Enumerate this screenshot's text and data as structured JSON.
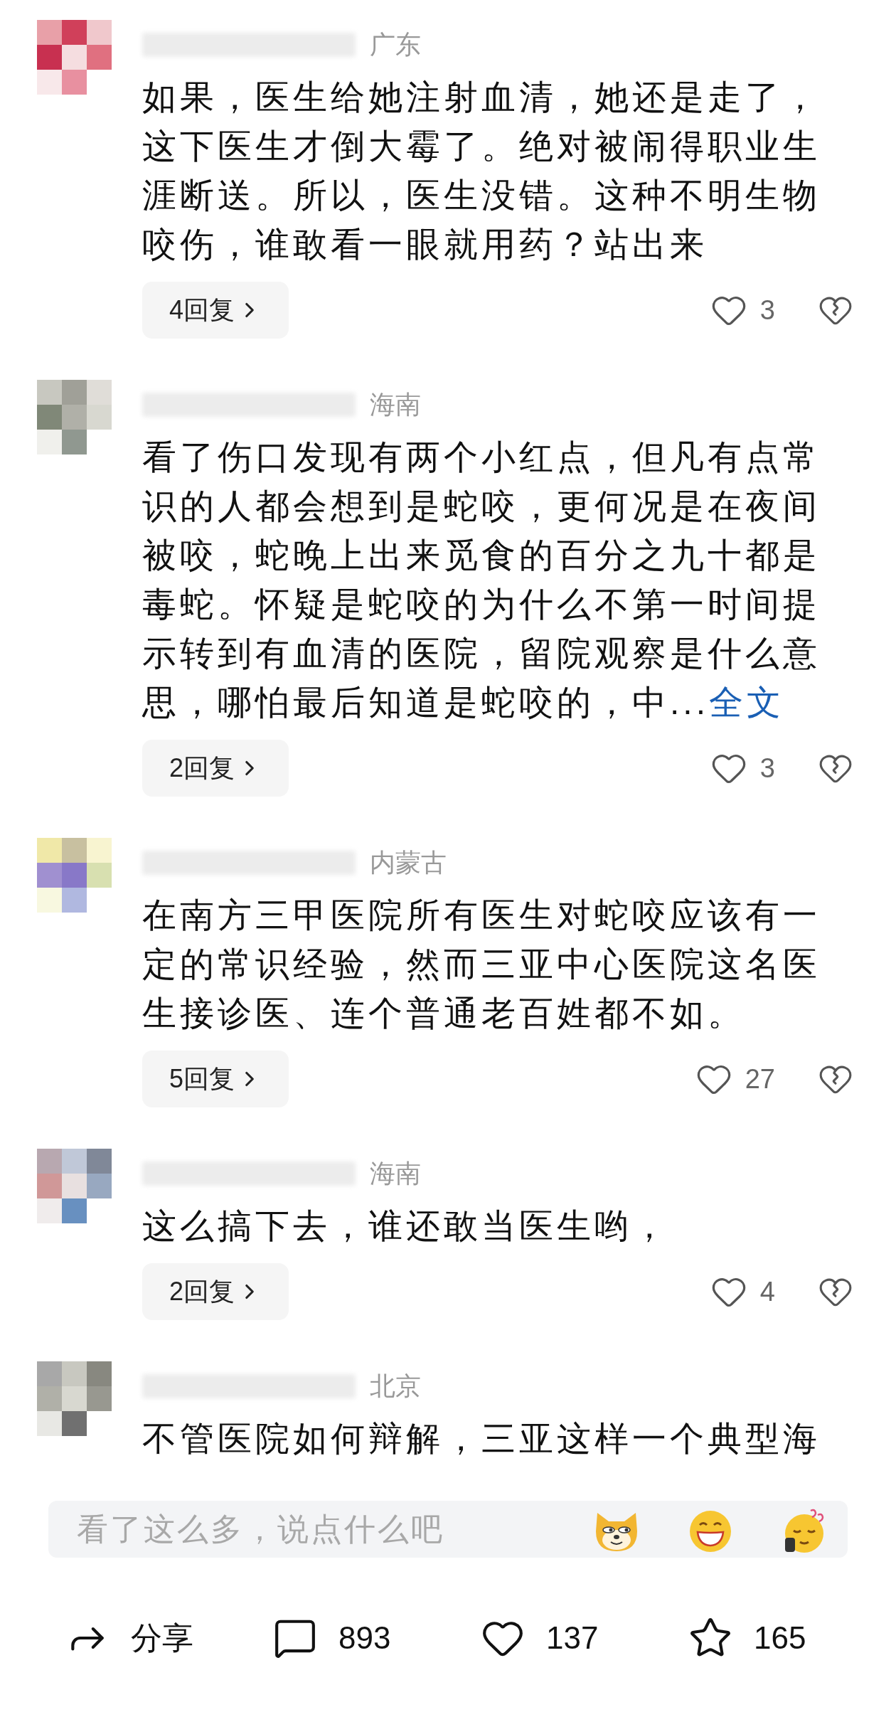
{
  "comments": [
    {
      "location": "广东",
      "text": "如果，医生给她注射血清，她还是走了，这下医生才倒大霉了。绝对被闹得职业生涯断送。所以，医生没错。这种不明生物咬伤，谁敢看一眼就用药？站出来",
      "replies": "4回复",
      "likes": "3"
    },
    {
      "location": "海南",
      "text": "看了伤口发现有两个小红点，但凡有点常识的人都会想到是蛇咬，更何况是在夜间被咬，蛇晚上出来觅食的百分之九十都是毒蛇。怀疑是蛇咬的为什么不第一时间提示转到有血清的医院，留院观察是什么意思，哪怕最后知道是蛇咬的，中...",
      "more_link": "全文",
      "replies": "2回复",
      "likes": "3"
    },
    {
      "location": "内蒙古",
      "text": "在南方三甲医院所有医生对蛇咬应该有一定的常识经验，然而三亚中心医院这名医生接诊医、连个普通老百姓都不如。",
      "replies": "5回复",
      "likes": "27"
    },
    {
      "location": "海南",
      "text": "这么搞下去，谁还敢当医生哟，",
      "replies": "2回复",
      "likes": "4"
    },
    {
      "location": "北京",
      "text": "不管医院如何辩解，三亚这样一个典型海"
    }
  ],
  "comment_box": {
    "placeholder": "看了这么多，说点什么吧"
  },
  "toolbar": [
    {
      "kind": "share",
      "label": "分享"
    },
    {
      "kind": "comment",
      "label": "893"
    },
    {
      "kind": "like",
      "label": "137"
    },
    {
      "kind": "favorite",
      "label": "165"
    }
  ]
}
